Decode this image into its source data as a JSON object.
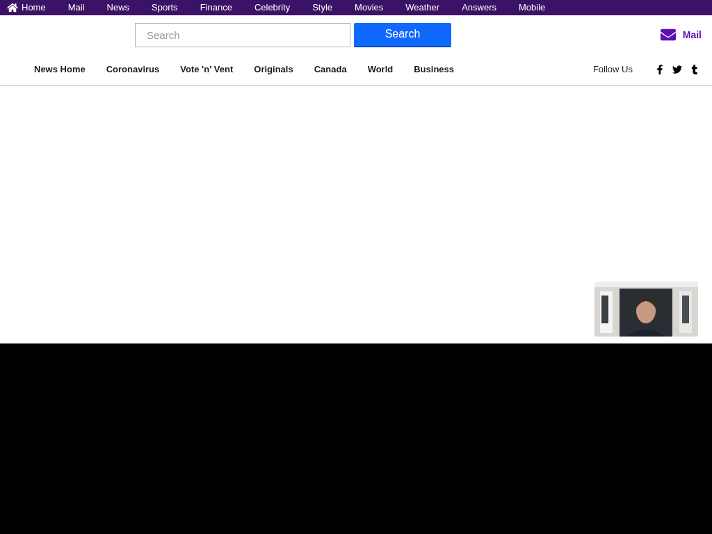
{
  "top_nav": {
    "items": [
      "Home",
      "Mail",
      "News",
      "Sports",
      "Finance",
      "Celebrity",
      "Style",
      "Movies",
      "Weather",
      "Answers",
      "Mobile"
    ]
  },
  "header": {
    "search": {
      "placeholder": "Search"
    },
    "search_button": "Search",
    "mail_link": "Mail"
  },
  "section_nav": {
    "items": [
      "News Home",
      "Coronavirus",
      "Vote 'n' Vent",
      "Originals",
      "Canada",
      "World",
      "Business"
    ],
    "follow_label": "Follow Us"
  }
}
